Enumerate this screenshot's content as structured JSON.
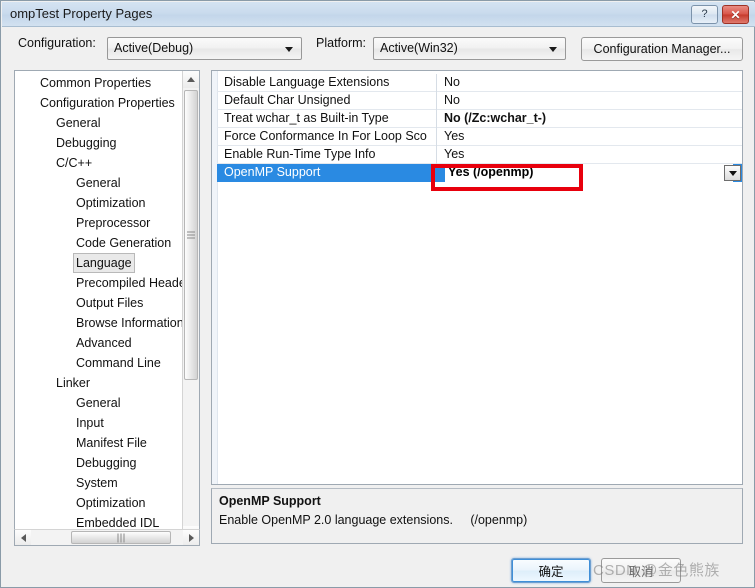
{
  "window": {
    "title": "ompTest Property Pages",
    "help_button": "?",
    "close_button": "✕"
  },
  "config_bar": {
    "configuration_label": "Configuration:",
    "configuration_value": "Active(Debug)",
    "platform_label": "Platform:",
    "platform_value": "Active(Win32)",
    "configuration_manager_button": "Configuration Manager..."
  },
  "tree": {
    "items": [
      {
        "label": "Common Properties",
        "depth": 0,
        "selected": false
      },
      {
        "label": "Configuration Properties",
        "depth": 0,
        "selected": false
      },
      {
        "label": "General",
        "depth": 1,
        "selected": false
      },
      {
        "label": "Debugging",
        "depth": 1,
        "selected": false
      },
      {
        "label": "C/C++",
        "depth": 1,
        "selected": false
      },
      {
        "label": "General",
        "depth": 2,
        "selected": false
      },
      {
        "label": "Optimization",
        "depth": 2,
        "selected": false
      },
      {
        "label": "Preprocessor",
        "depth": 2,
        "selected": false
      },
      {
        "label": "Code Generation",
        "depth": 2,
        "selected": false
      },
      {
        "label": "Language",
        "depth": 2,
        "selected": true
      },
      {
        "label": "Precompiled Headers",
        "depth": 2,
        "selected": false
      },
      {
        "label": "Output Files",
        "depth": 2,
        "selected": false
      },
      {
        "label": "Browse Information",
        "depth": 2,
        "selected": false
      },
      {
        "label": "Advanced",
        "depth": 2,
        "selected": false
      },
      {
        "label": "Command Line",
        "depth": 2,
        "selected": false
      },
      {
        "label": "Linker",
        "depth": 1,
        "selected": false
      },
      {
        "label": "General",
        "depth": 2,
        "selected": false
      },
      {
        "label": "Input",
        "depth": 2,
        "selected": false
      },
      {
        "label": "Manifest File",
        "depth": 2,
        "selected": false
      },
      {
        "label": "Debugging",
        "depth": 2,
        "selected": false
      },
      {
        "label": "System",
        "depth": 2,
        "selected": false
      },
      {
        "label": "Optimization",
        "depth": 2,
        "selected": false
      },
      {
        "label": "Embedded IDL",
        "depth": 2,
        "selected": false
      }
    ]
  },
  "property_grid": {
    "rows": [
      {
        "name": "Disable Language Extensions",
        "value": "No",
        "bold": false,
        "selected": false
      },
      {
        "name": "Default Char Unsigned",
        "value": "No",
        "bold": false,
        "selected": false
      },
      {
        "name": "Treat wchar_t as Built-in Type",
        "value": "No (/Zc:wchar_t-)",
        "bold": true,
        "selected": false
      },
      {
        "name": "Force Conformance In For Loop Sco",
        "value": "Yes",
        "bold": false,
        "selected": false
      },
      {
        "name": "Enable Run-Time Type Info",
        "value": "Yes",
        "bold": false,
        "selected": false
      },
      {
        "name": "OpenMP Support",
        "value": "Yes (/openmp)",
        "bold": true,
        "selected": true
      }
    ],
    "editor_value": "Yes (/openmp)"
  },
  "description": {
    "title": "OpenMP Support",
    "body": "Enable OpenMP 2.0 language extensions.     (/openmp)"
  },
  "footer": {
    "ok_button": "确定",
    "cancel_button": "取消",
    "watermark": "CSDN @金色熊族"
  },
  "colors": {
    "selection_blue": "#2a8ae2",
    "highlight_red": "#e8000d",
    "titlebar_blue": "#cadbed"
  }
}
